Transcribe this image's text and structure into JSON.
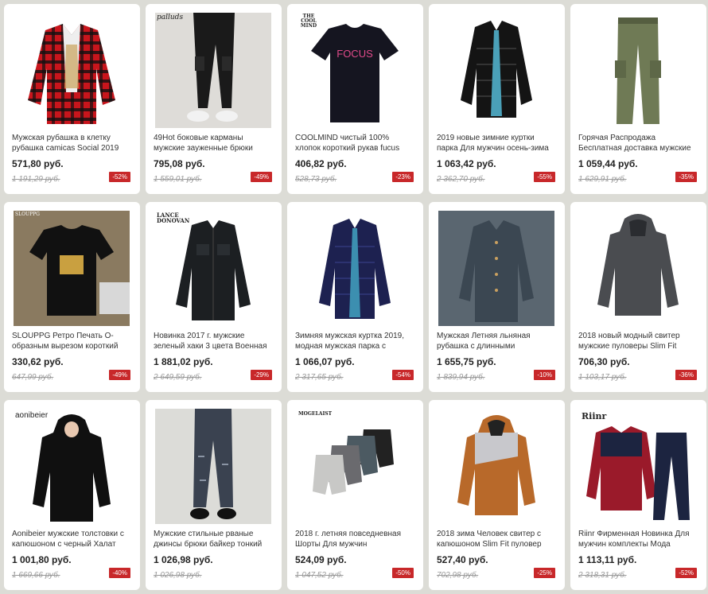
{
  "products": [
    {
      "title": "Мужская рубашка в клетку рубашка camicas Social 2019",
      "price": "571,80 руб.",
      "old_price": "1 191,29 руб.",
      "discount": "-52%",
      "brand": "",
      "icon": "red-plaid-shirt-icon",
      "color": "#c8151c"
    },
    {
      "title": "49Hot боковые карманы мужские зауженные брюки",
      "price": "795,08 руб.",
      "old_price": "1 559,01 руб.",
      "discount": "-49%",
      "brand": "palluds",
      "icon": "black-cargo-pants-icon",
      "color": "#1a1a1a"
    },
    {
      "title": "COOLMIND чистый 100% хлопок короткий рукав fucus",
      "price": "406,82 руб.",
      "old_price": "528,73 руб.",
      "discount": "-23%",
      "brand": "THE COOL MIND",
      "print": "FOCUS",
      "icon": "black-tshirt-icon",
      "color": "#151520"
    },
    {
      "title": "2019 новые зимние куртки парка Для мужчин осень-зима",
      "price": "1 063,42 руб.",
      "old_price": "2 362,70 руб.",
      "discount": "-55%",
      "brand": "",
      "icon": "black-puffer-jacket-icon",
      "color": "#121212"
    },
    {
      "title": "Горячая Распродажа Бесплатная доставка мужские",
      "price": "1 059,44 руб.",
      "old_price": "1 629,91 руб.",
      "discount": "-35%",
      "brand": "",
      "icon": "green-cargo-pants-icon",
      "color": "#6f7a55"
    },
    {
      "title": "SLOUPPG Ретро Печать O-образным вырезом короткий",
      "price": "330,62 руб.",
      "old_price": "647,99 руб.",
      "discount": "-49%",
      "brand": "SLOUPPG",
      "icon": "printed-tshirt-icon",
      "color": "#111111"
    },
    {
      "title": "Новинка 2017 г. мужские зеленый хаки 3 цвета Военная",
      "price": "1 881,02 руб.",
      "old_price": "2 649,59 руб.",
      "discount": "-29%",
      "brand": "LANCE DONOVAN",
      "icon": "military-jacket-icon",
      "color": "#1c1f22"
    },
    {
      "title": "Зимняя мужская куртка 2019, модная мужская парка с",
      "price": "1 066,07 руб.",
      "old_price": "2 317,65 руб.",
      "discount": "-54%",
      "brand": "",
      "icon": "navy-puffer-jacket-icon",
      "color": "#1d2150"
    },
    {
      "title": "Мужская Летняя льняная рубашка с длинными",
      "price": "1 655,75 руб.",
      "old_price": "1 839,94 руб.",
      "discount": "-10%",
      "brand": "",
      "icon": "linen-shirt-icon",
      "color": "#3b4752"
    },
    {
      "title": "2018 новый модный свитер мужские пуловеры Slim Fit",
      "price": "706,30 руб.",
      "old_price": "1 103,17 руб.",
      "discount": "-36%",
      "brand": "",
      "icon": "grey-hoodie-icon",
      "color": "#4a4c50"
    },
    {
      "title": "Aonibeier мужские толстовки с капюшоном с черный Халат",
      "price": "1 001,80 руб.",
      "old_price": "1 669,66 руб.",
      "discount": "-40%",
      "brand": "aonibeier",
      "icon": "black-long-hoodie-icon",
      "color": "#101010"
    },
    {
      "title": "Мужские стильные рваные джинсы брюки байкер тонкий",
      "price": "1 026,98 руб.",
      "old_price": "1 026,98 руб.",
      "discount": "",
      "brand": "",
      "icon": "ripped-jeans-icon",
      "color": "#3a4250"
    },
    {
      "title": "2018 г. летняя повседневная Шорты Для мужчин",
      "price": "524,09 руб.",
      "old_price": "1 047,52 руб.",
      "discount": "-50%",
      "brand": "MOGELAIST",
      "icon": "shorts-set-icon",
      "color": "#4c5a62"
    },
    {
      "title": "2018 зима Человек свитер с капюшоном Slim Fit пуловер",
      "price": "527,40 руб.",
      "old_price": "702,98 руб.",
      "discount": "-25%",
      "brand": "",
      "icon": "orange-hoodie-icon",
      "color": "#b8692a"
    },
    {
      "title": "Riinr Фирменная Новинка Для мужчин комплекты Мода",
      "price": "1 113,11 руб.",
      "old_price": "2 318,31 руб.",
      "discount": "-52%",
      "brand": "Riinr",
      "icon": "tracksuit-icon",
      "color": "#9a1a2a"
    }
  ]
}
